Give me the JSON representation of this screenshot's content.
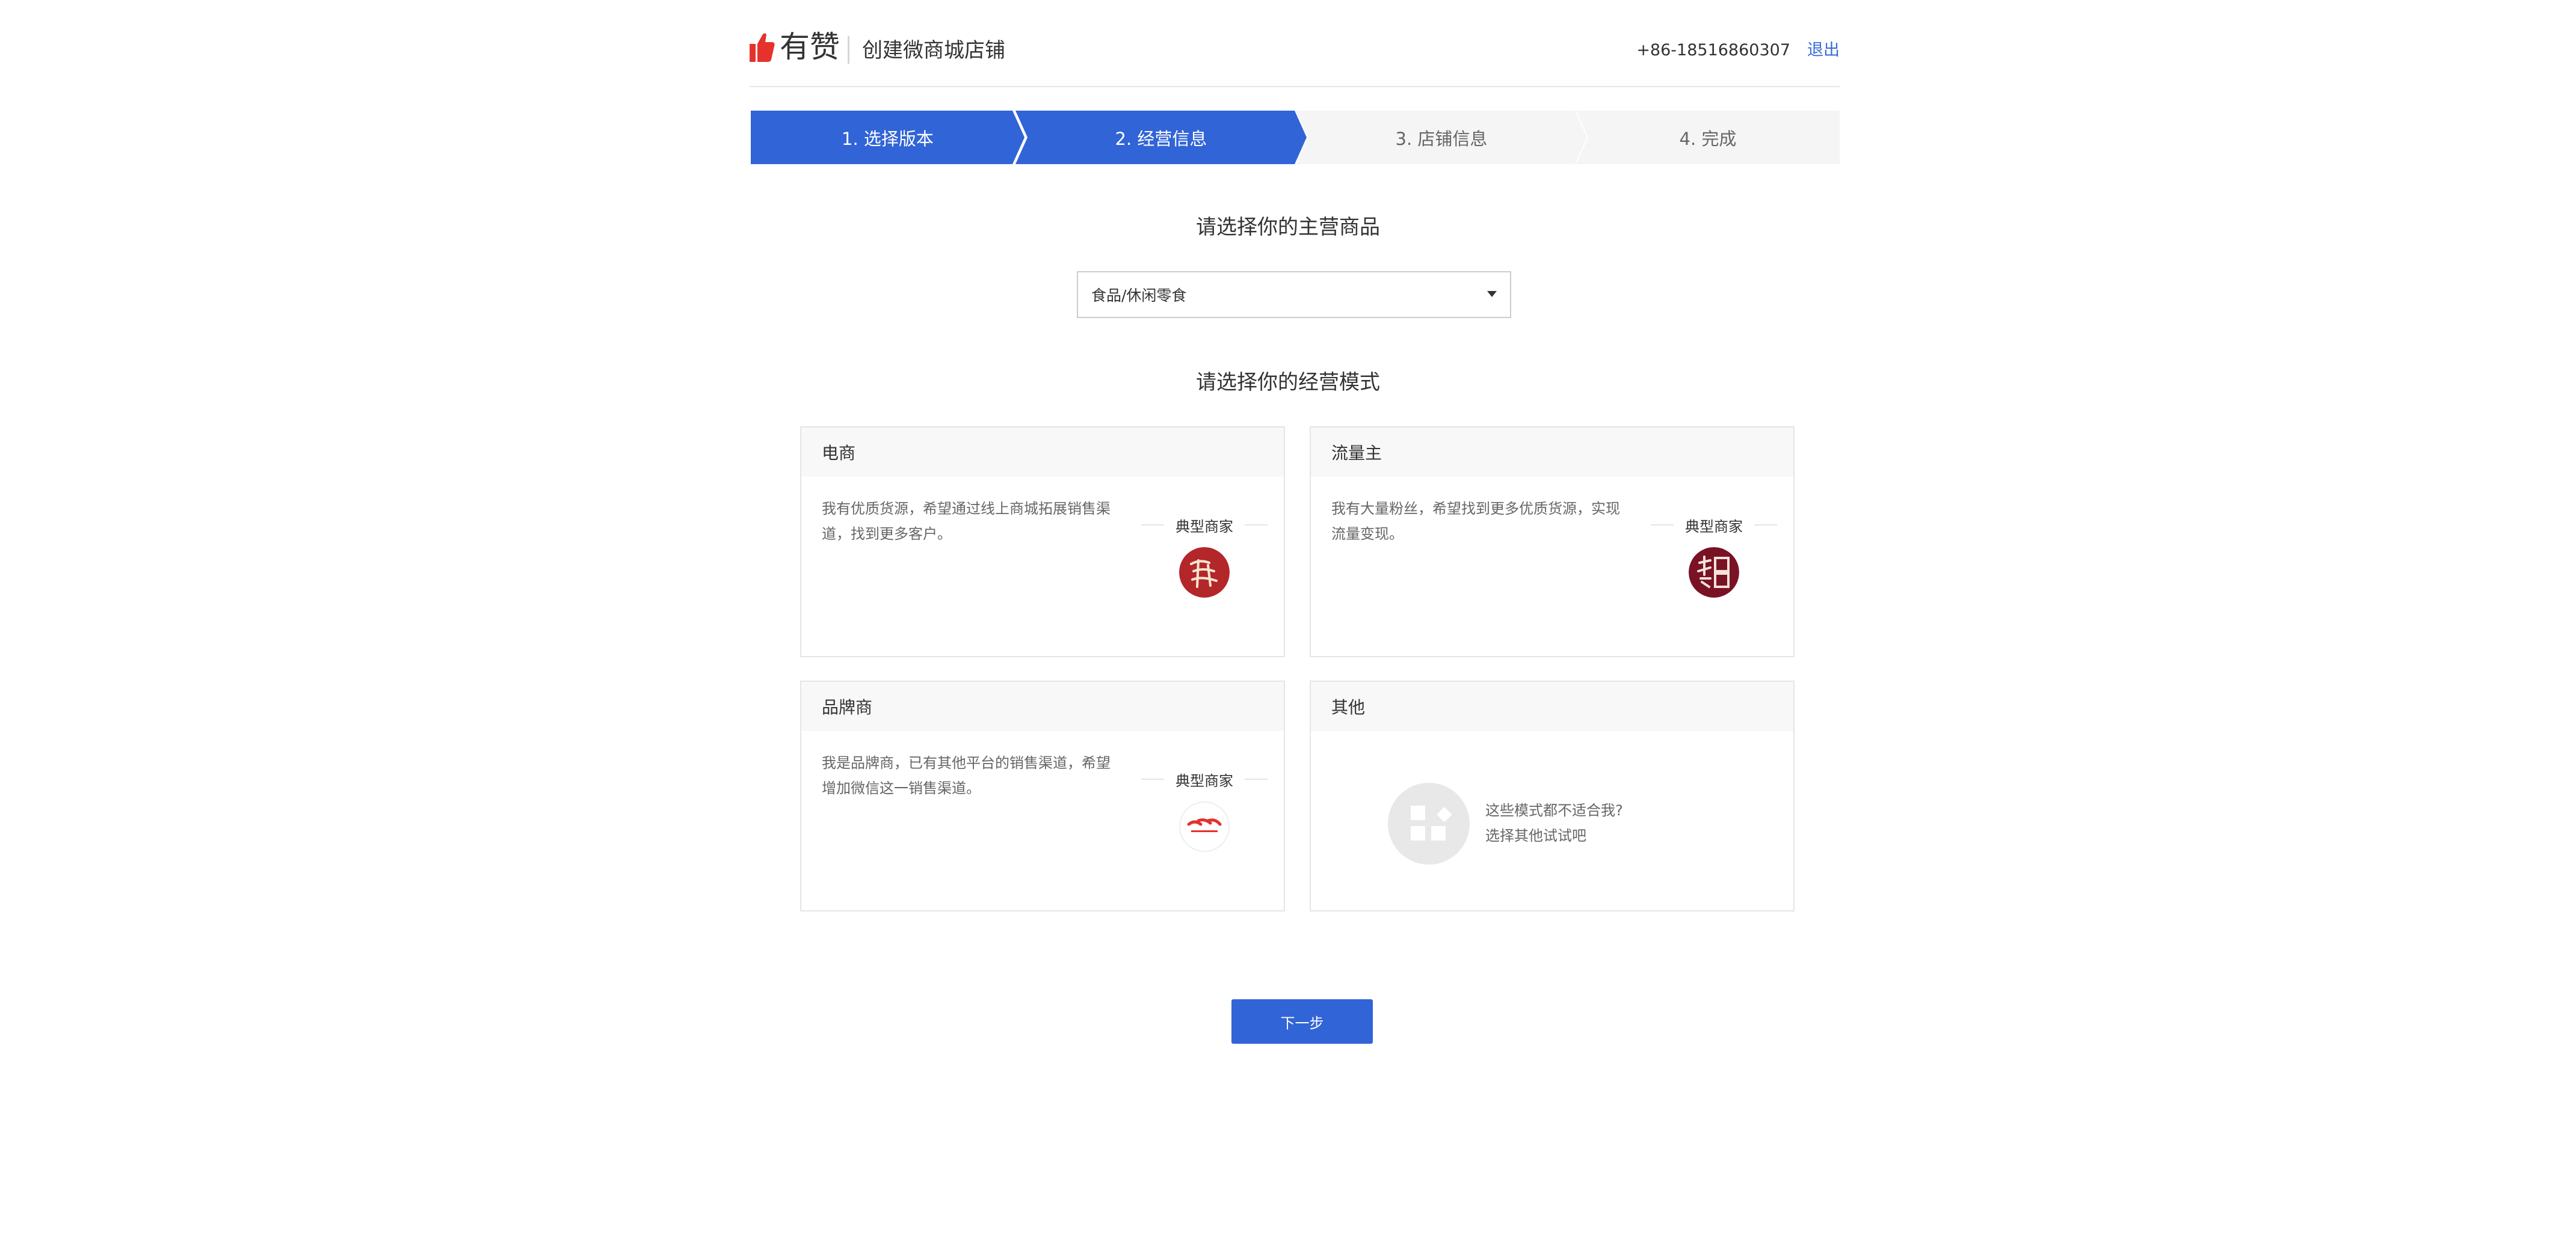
{
  "header": {
    "logo_text": "有赞",
    "title": "创建微商城店铺",
    "phone": "+86-18516860307",
    "logout": "退出"
  },
  "steps": [
    {
      "label": "1. 选择版本",
      "state": "done"
    },
    {
      "label": "2. 经营信息",
      "state": "active"
    },
    {
      "label": "3. 店铺信息",
      "state": "todo"
    },
    {
      "label": "4. 完成",
      "state": "todo"
    }
  ],
  "main_goods": {
    "title": "请选择你的主营商品",
    "selected": "食品/休闲零食"
  },
  "business_mode": {
    "title": "请选择你的经营模式",
    "typical_label": "典型商家",
    "cards": [
      {
        "title": "电商",
        "desc": "我有优质货源，希望通过线上商城拓展销售渠道，找到更多客户。"
      },
      {
        "title": "流量主",
        "desc": "我有大量粉丝，希望找到更多优质货源，实现流量变现。"
      },
      {
        "title": "品牌商",
        "desc": "我是品牌商，已有其他平台的销售渠道，希望增加微信这一销售渠道。"
      },
      {
        "title": "其他",
        "line1": "这些模式都不适合我?",
        "line2": "选择其他试试吧"
      }
    ]
  },
  "next_button": "下一步",
  "colors": {
    "primary": "#3164d6",
    "link": "#3869d7",
    "step_todo_bg": "#f5f5f5",
    "border": "#e5e5e5"
  },
  "icons": {
    "logo": "thumbs-up-icon",
    "select": "caret-down-icon",
    "other": "apps-grid-icon"
  }
}
